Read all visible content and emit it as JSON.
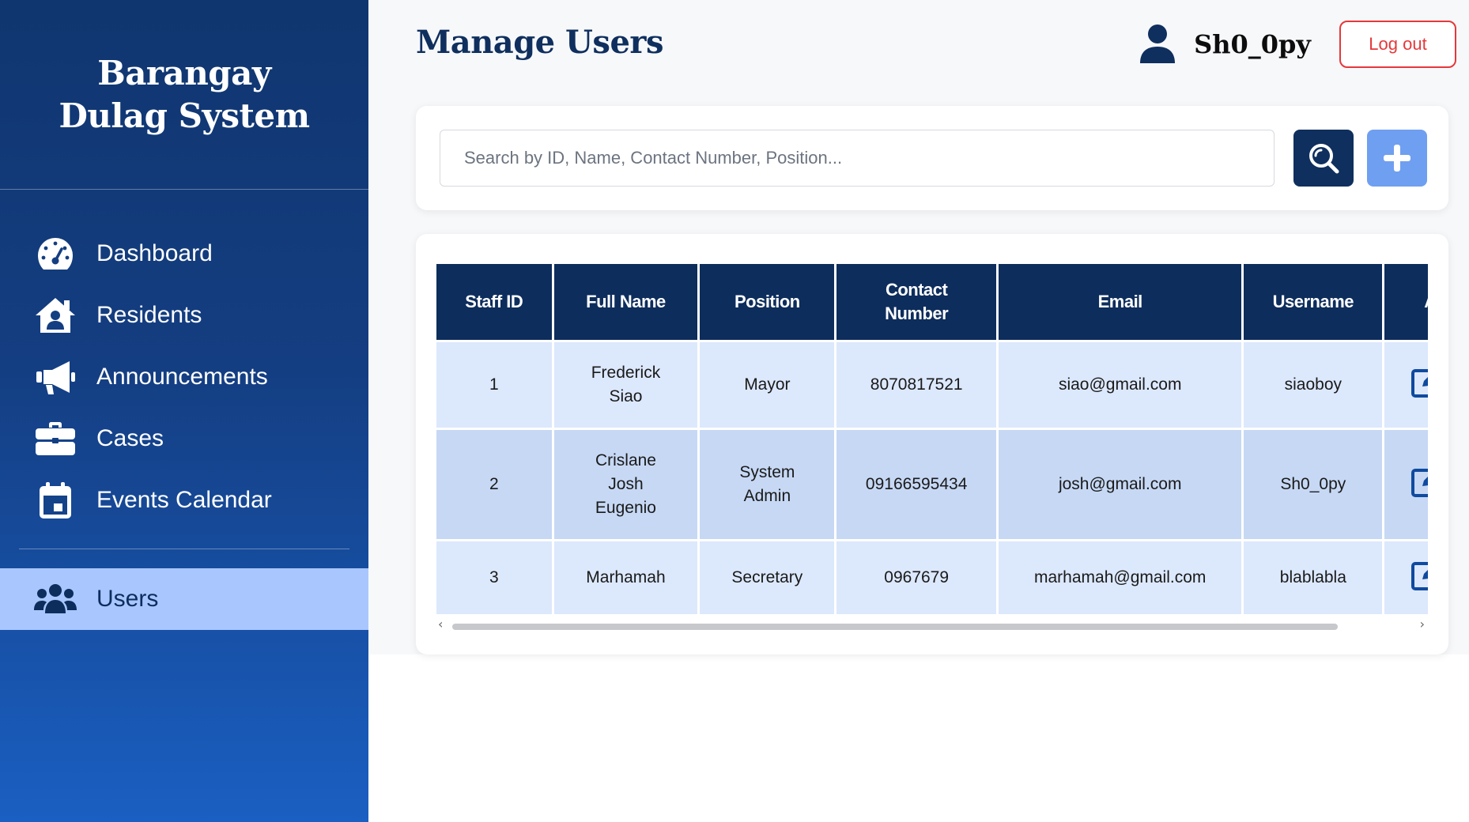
{
  "sidebar": {
    "brand": "Barangay Dulag System",
    "items": [
      {
        "label": "Dashboard",
        "icon": "gauge-icon"
      },
      {
        "label": "Residents",
        "icon": "house-user-icon"
      },
      {
        "label": "Announcements",
        "icon": "megaphone-icon"
      },
      {
        "label": "Cases",
        "icon": "briefcase-icon"
      },
      {
        "label": "Events Calendar",
        "icon": "calendar-icon"
      }
    ],
    "active_item": {
      "label": "Users",
      "icon": "users-icon"
    }
  },
  "header": {
    "title": "Manage Users",
    "username": "Sh0_0py",
    "logout_label": "Log out"
  },
  "search": {
    "placeholder": "Search by ID, Name, Contact Number, Position...",
    "value": ""
  },
  "table": {
    "columns": [
      "Staff ID",
      "Full Name",
      "Position",
      "Contact Number",
      "Email",
      "Username",
      "Actions"
    ],
    "rows": [
      {
        "id": "1",
        "name": "Frederick Siao",
        "position": "Mayor",
        "contact": "8070817521",
        "email": "siao@gmail.com",
        "username": "siaoboy"
      },
      {
        "id": "2",
        "name": "Crislane Josh Eugenio",
        "position": "System Admin",
        "contact": "09166595434",
        "email": "josh@gmail.com",
        "username": "Sh0_0py"
      },
      {
        "id": "3",
        "name": "Marhamah",
        "position": "Secretary",
        "contact": "0967679",
        "email": "marhamah@gmail.com",
        "username": "blablabla"
      }
    ]
  },
  "colors": {
    "sidebar_top": "#10366f",
    "sidebar_bottom": "#1a5fc2",
    "active_nav": "#a9c6ff",
    "header_navy": "#0d2d5c",
    "logout_red": "#e5383b",
    "add_button": "#6f9ff0",
    "row_light": "#dce8fc",
    "row_dark": "#c6d8f4"
  }
}
